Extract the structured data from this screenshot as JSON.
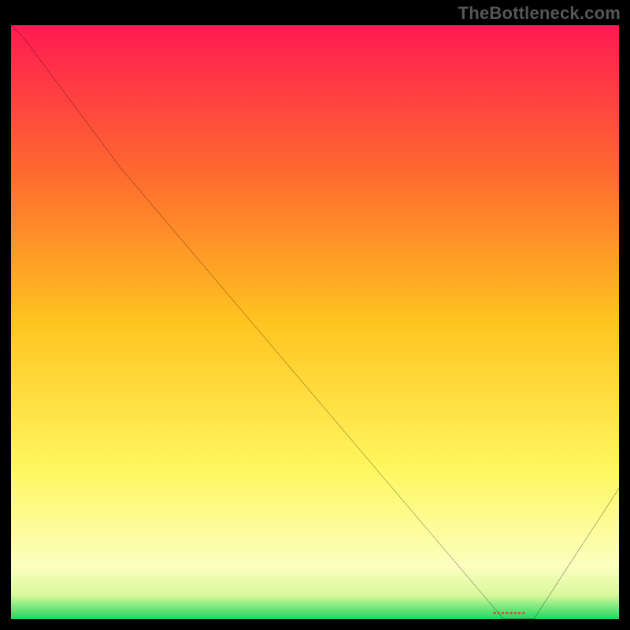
{
  "watermark": "TheBottleneck.com",
  "chart_data": {
    "type": "line",
    "title": "",
    "xlabel": "",
    "ylabel": "",
    "x": [
      0,
      2,
      18,
      81,
      84,
      86,
      100
    ],
    "values": [
      100,
      98,
      76,
      0,
      0,
      0,
      22
    ],
    "xlim": [
      0,
      100
    ],
    "ylim": [
      0,
      100
    ],
    "annotations": [
      {
        "text": "▪▪▪▪▪▪▪▪",
        "x": 82,
        "y": 1
      }
    ],
    "background": {
      "type": "vertical-gradient",
      "stops": [
        {
          "pos": 0.0,
          "color": "#ff1a52"
        },
        {
          "pos": 0.25,
          "color": "#ff6a2f"
        },
        {
          "pos": 0.5,
          "color": "#ffc420"
        },
        {
          "pos": 0.75,
          "color": "#fff760"
        },
        {
          "pos": 0.91,
          "color": "#fcffbf"
        },
        {
          "pos": 0.96,
          "color": "#d8f89c"
        },
        {
          "pos": 1.0,
          "color": "#1fd860"
        }
      ]
    }
  },
  "colors": {
    "line": "#000000",
    "marker": "#d05040",
    "frame": "#000000"
  }
}
